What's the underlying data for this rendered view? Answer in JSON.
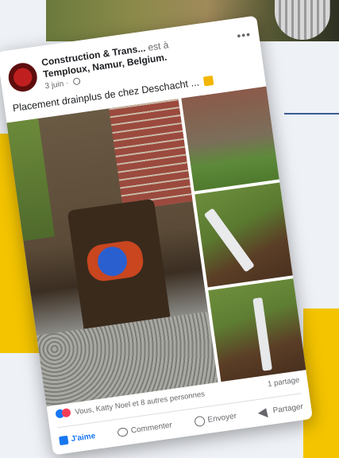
{
  "post": {
    "page_name": "Construction & Trans...",
    "page_suffix": "est à",
    "location": "Temploux, Namur, Belgium.",
    "date": "3 juin ·",
    "text": "Placement drainplus de chez Deschacht ...",
    "more_icon": "more-options-icon",
    "reactions_text": "Vous, Katty Noel et 8 autres personnes",
    "shares_text": "1 partage"
  },
  "actions": {
    "like": "J'aime",
    "comment": "Commenter",
    "send": "Envoyer",
    "share": "Partager"
  },
  "colors": {
    "accent_yellow": "#f4c400",
    "facebook_blue": "#1877f2",
    "love_red": "#f33e58",
    "background": "#eef1f6"
  }
}
